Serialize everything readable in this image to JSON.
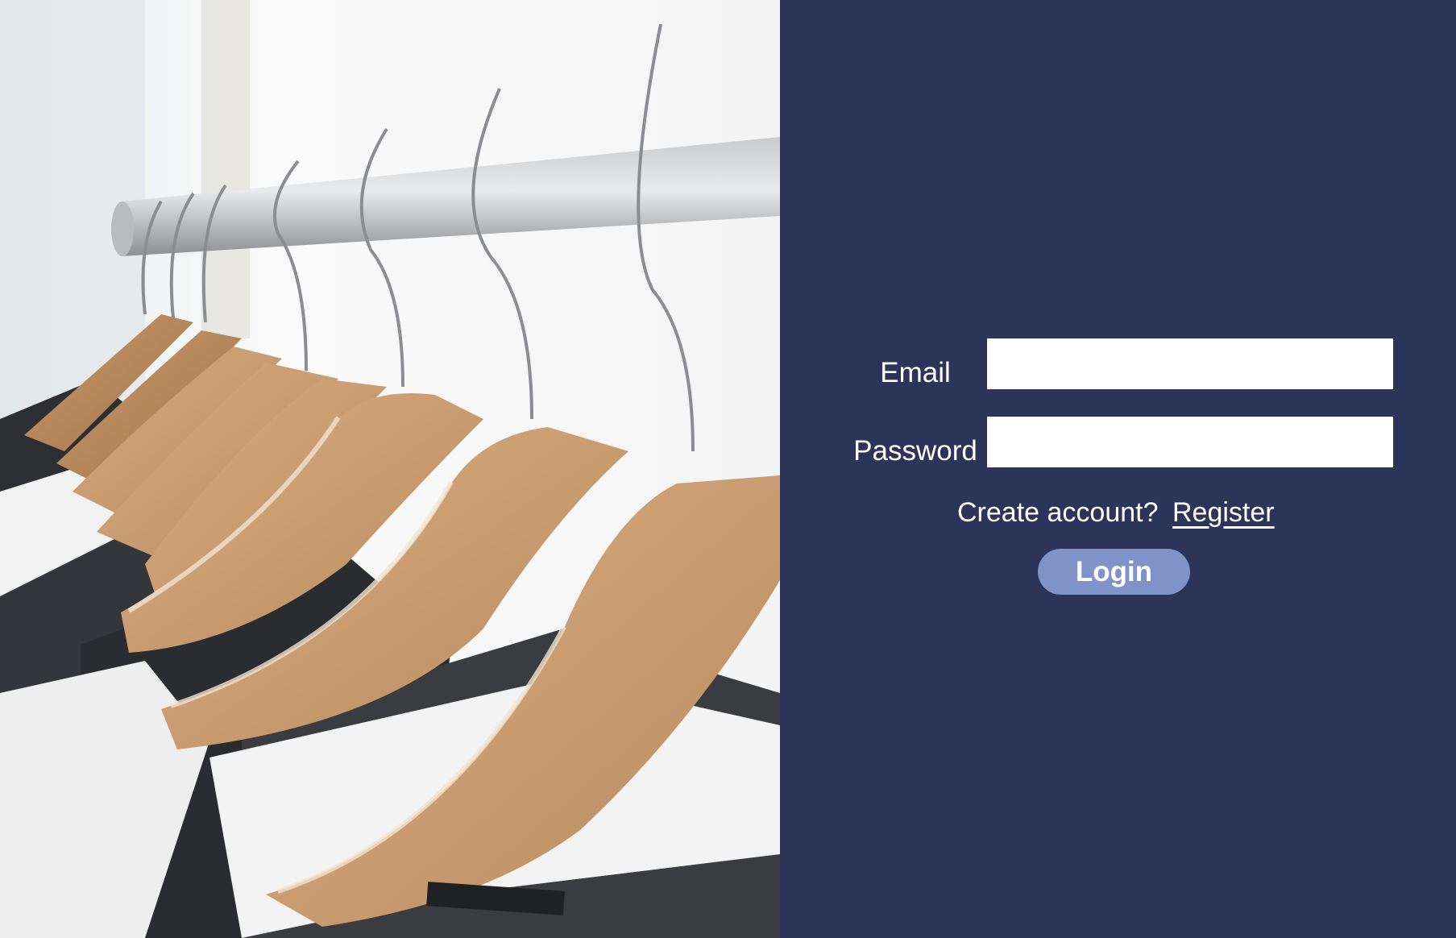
{
  "hero_image": {
    "icon": "clothes-hangers-photo"
  },
  "login_form": {
    "email_label": "Email",
    "email_value": "",
    "password_label": "Password",
    "password_value": "",
    "register_prompt": "Create account?",
    "register_link": "Register",
    "login_button": "Login"
  },
  "colors": {
    "panel_background": "#2c3459",
    "login_button": "#7f93c8",
    "text": "#ffffff",
    "input_background": "#ffffff"
  }
}
